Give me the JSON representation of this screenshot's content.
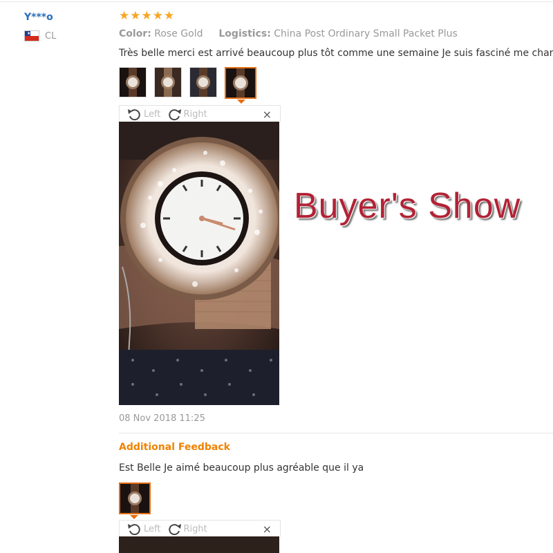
{
  "reviewer": {
    "name": "Y***o",
    "country_code": "CL"
  },
  "rating": {
    "stars": 5,
    "star_glyph": "★"
  },
  "review": {
    "color_label": "Color:",
    "color_value": "Rose Gold",
    "logistics_label": "Logistics:",
    "logistics_value": "China Post Ordinary Small Packet Plus",
    "text": "Très belle merci est arrivé beaucoup plus tôt comme une semaine Je suis fasciné me charme",
    "thumbnail_count": 4,
    "active_thumbnail": 4,
    "date": "08 Nov 2018 11:25"
  },
  "viewer": {
    "rotate_left_label": "Left",
    "rotate_right_label": "Right",
    "close_glyph": "×"
  },
  "overlay": {
    "title": "Buyer's Show"
  },
  "additional": {
    "heading": "Additional Feedback",
    "text": "Est Belle Je aimé beaucoup plus agréable que il ya",
    "thumbnail_count": 1
  },
  "colors": {
    "accent": "#e46e13",
    "username": "#2a6ebb",
    "star": "#f7a623",
    "overlay_text": "#b22235"
  }
}
